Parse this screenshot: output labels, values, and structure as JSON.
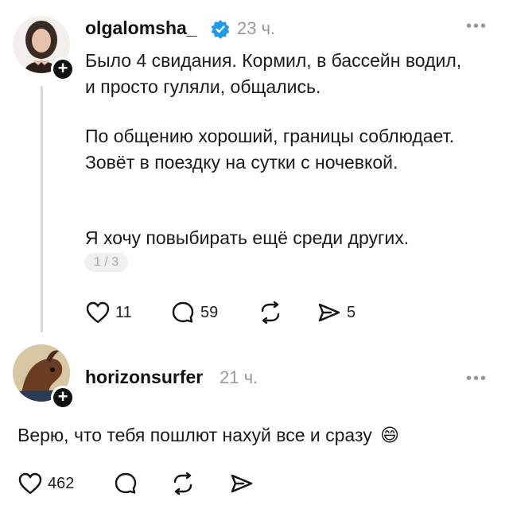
{
  "posts": [
    {
      "username": "olgalomsha_",
      "verified": true,
      "time": "23 ч.",
      "paragraphs": [
        "Было 4 свидания. Кормил, в бассейн водил, и просто гуляли, общались.",
        "По общению хороший, границы соблюдает. Зовёт в поездку на сутки с ночевкой.",
        "Я хочу повыбирать ещё среди других."
      ],
      "pager": "1 / 3",
      "likes": "11",
      "replies": "59",
      "reposts": "",
      "shares": "5"
    },
    {
      "username": "horizonsurfer",
      "time": "21 ч.",
      "text": "Верю, что тебя пошлют нахуй все и сразу",
      "emoji": "😄",
      "likes": "462"
    }
  ],
  "colors": {
    "verified": "#1d9bf0",
    "muted": "#999999",
    "thread_line": "#d7d7d7"
  },
  "icons": [
    "heart-icon",
    "comment-icon",
    "repost-icon",
    "share-icon",
    "more-icon",
    "verified-icon",
    "plus-icon"
  ]
}
